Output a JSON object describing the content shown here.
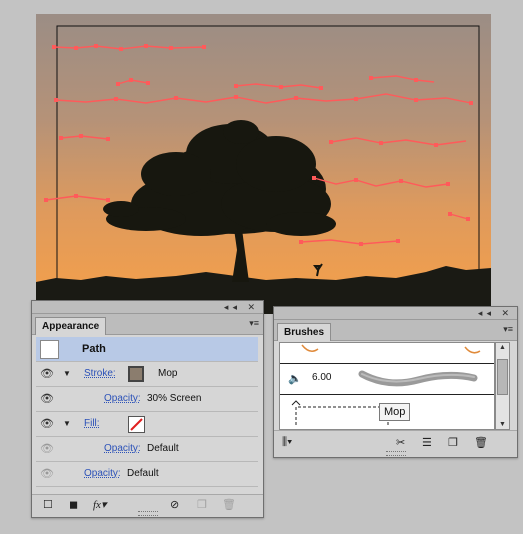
{
  "appearance": {
    "tab_label": "Appearance",
    "titlebar_icons": "◂◂ ✕",
    "menu_icon": "▾≡",
    "rows": {
      "path_label": "Path",
      "stroke_label": "Stroke:",
      "stroke_value": "Mop",
      "stroke_opacity_label": "Opacity:",
      "stroke_opacity_value": "30% Screen",
      "fill_label": "Fill:",
      "fill_opacity_label": "Opacity:",
      "fill_opacity_value": "Default",
      "opacity_label": "Opacity:",
      "opacity_value": "Default"
    },
    "bottom_icons": [
      "add-new-stroke-icon",
      "add-new-fill-icon",
      "fx-menu-icon",
      "clear-appearance-icon",
      "duplicate-item-icon",
      "delete-item-icon"
    ]
  },
  "brushes": {
    "tab_label": "Brushes",
    "titlebar_icons": "◂◂ ✕",
    "menu_icon": "▾≡",
    "selected_brush_size": "6.00",
    "tooltip": "Mop",
    "bottom_icons": [
      "brush-libraries-menu-icon",
      "remove-brush-stroke-icon",
      "brush-options-icon",
      "new-brush-icon",
      "delete-brush-icon"
    ]
  },
  "colors": {
    "sky_top": "#9c8f86",
    "sky_bottom": "#f59a4a",
    "path_highlight": "#ff5a5a",
    "panel_bg": "#d6d6d6",
    "selected_row": "#b8c9e6"
  }
}
